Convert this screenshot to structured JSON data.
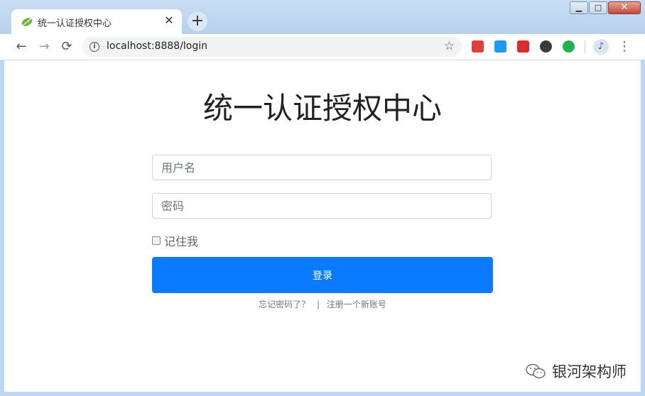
{
  "browser": {
    "tab_title": "统一认证授权中心",
    "tab_close": "✕",
    "new_tab": "+",
    "url": "localhost:8888/login",
    "nav": {
      "back": "←",
      "forward": "→",
      "reload": "⟳"
    },
    "star": "☆",
    "menu": "⋮",
    "window_controls": {
      "minimize": "▁",
      "maximize": "□",
      "close": "✕"
    },
    "extensions": [
      {
        "name": "dice-extension-icon",
        "color": "#e0403a"
      },
      {
        "name": "bird-extension-icon",
        "color": "#1d9bf0"
      },
      {
        "name": "fe-extension-icon",
        "color": "#d92b2b"
      },
      {
        "name": "evernote-extension-icon",
        "color": "#3b3b3b"
      },
      {
        "name": "green-extension-icon",
        "color": "#22b24c"
      }
    ],
    "profile_glyph": "♪"
  },
  "page": {
    "title": "统一认证授权中心",
    "username_placeholder": "用户名",
    "password_placeholder": "密码",
    "remember_label": "记住我",
    "login_label": "登录",
    "forgot_label": "忘记密码了？",
    "divider": "|",
    "register_label": "注册一个新账号"
  },
  "watermark": {
    "text": "银河架构师"
  },
  "colors": {
    "primary": "#0a7bff",
    "chrome_frame": "#bcd7f2"
  }
}
